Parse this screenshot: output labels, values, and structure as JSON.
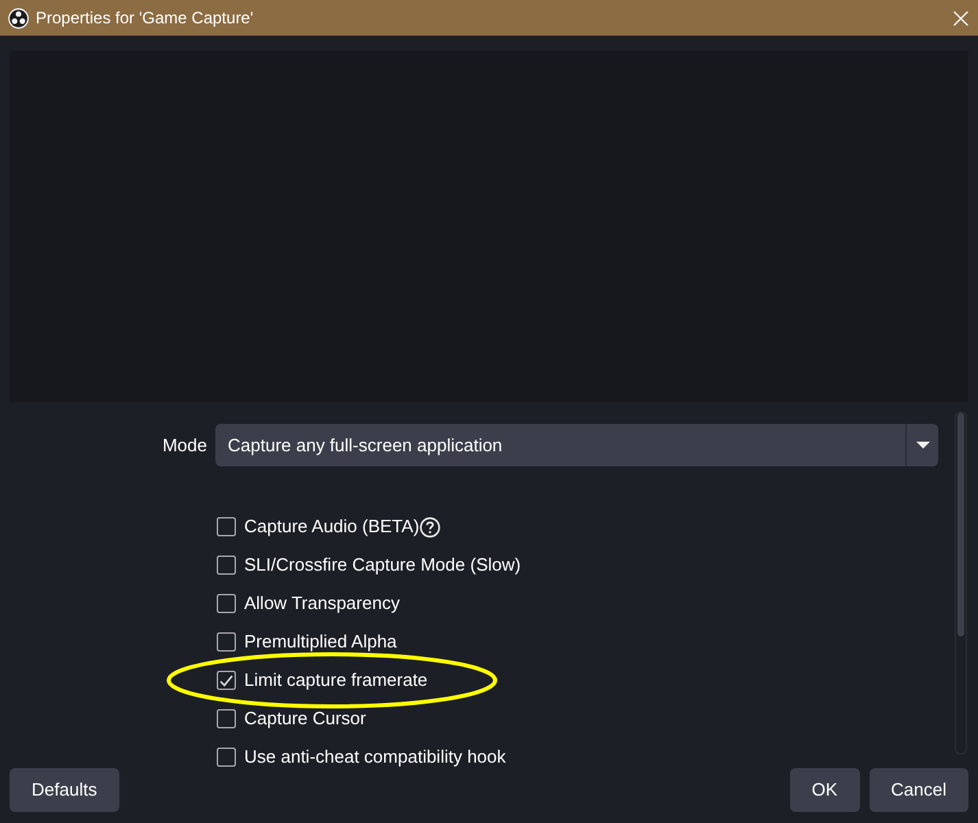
{
  "window": {
    "title": "Properties for 'Game Capture'"
  },
  "properties": {
    "mode": {
      "label": "Mode",
      "value": "Capture any full-screen application"
    },
    "checkboxes": [
      {
        "label": "Capture Audio (BETA)",
        "checked": false,
        "help": true,
        "highlighted": false
      },
      {
        "label": "SLI/Crossfire Capture Mode (Slow)",
        "checked": false,
        "help": false,
        "highlighted": false
      },
      {
        "label": "Allow Transparency",
        "checked": false,
        "help": false,
        "highlighted": false
      },
      {
        "label": "Premultiplied Alpha",
        "checked": false,
        "help": false,
        "highlighted": false
      },
      {
        "label": "Limit capture framerate",
        "checked": true,
        "help": false,
        "highlighted": true
      },
      {
        "label": "Capture Cursor",
        "checked": false,
        "help": false,
        "highlighted": false
      },
      {
        "label": "Use anti-cheat compatibility hook",
        "checked": false,
        "help": false,
        "highlighted": false
      }
    ]
  },
  "footer": {
    "left_buttons": [
      "Defaults"
    ],
    "right_buttons": [
      "OK",
      "Cancel"
    ]
  }
}
